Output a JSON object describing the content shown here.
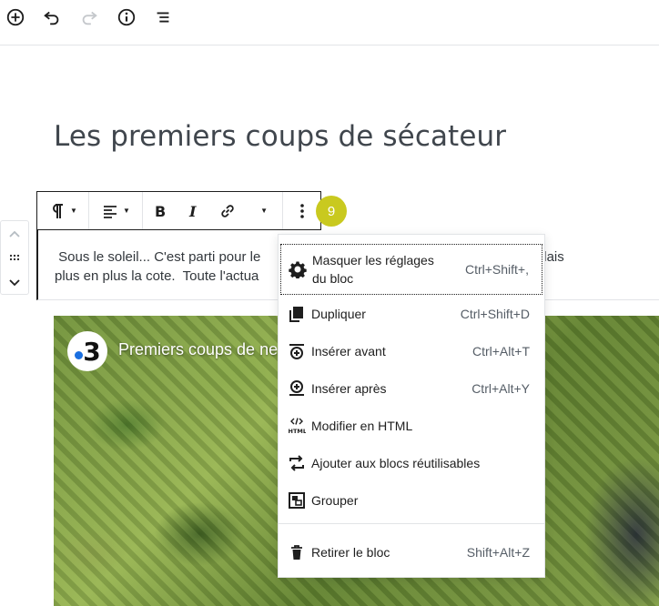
{
  "post": {
    "title": "Les premiers coups de sécateur",
    "paragraph": " Sous le soleil... C'est parti pour le                                                   vignoble bordelais\nplus en plus la cote.  Toute l'actua"
  },
  "video": {
    "logo_text": "3",
    "title": "Premiers coups de                                                                        ne"
  },
  "toolbar": {
    "badge": "9"
  },
  "menu": {
    "items": [
      {
        "label": "Masquer les réglages\ndu bloc",
        "shortcut": "Ctrl+Shift+,",
        "icon": "gear-icon"
      },
      {
        "label": "Dupliquer",
        "shortcut": "Ctrl+Shift+D",
        "icon": "duplicate-icon"
      },
      {
        "label": "Insérer avant",
        "shortcut": "Ctrl+Alt+T",
        "icon": "insert-before-icon"
      },
      {
        "label": "Insérer après",
        "shortcut": "Ctrl+Alt+Y",
        "icon": "insert-after-icon"
      },
      {
        "label": "Modifier en HTML",
        "shortcut": "",
        "icon": "html-icon"
      },
      {
        "label": "Ajouter aux blocs réutilisables",
        "shortcut": "",
        "icon": "reusable-icon"
      },
      {
        "label": "Grouper",
        "shortcut": "",
        "icon": "group-icon"
      },
      {
        "label": "Retirer le bloc",
        "shortcut": "Shift+Alt+Z",
        "icon": "trash-icon"
      }
    ]
  },
  "colors": {
    "accent_badge": "#c9c91f",
    "text": "#1e1e1e",
    "muted": "#555d66"
  }
}
